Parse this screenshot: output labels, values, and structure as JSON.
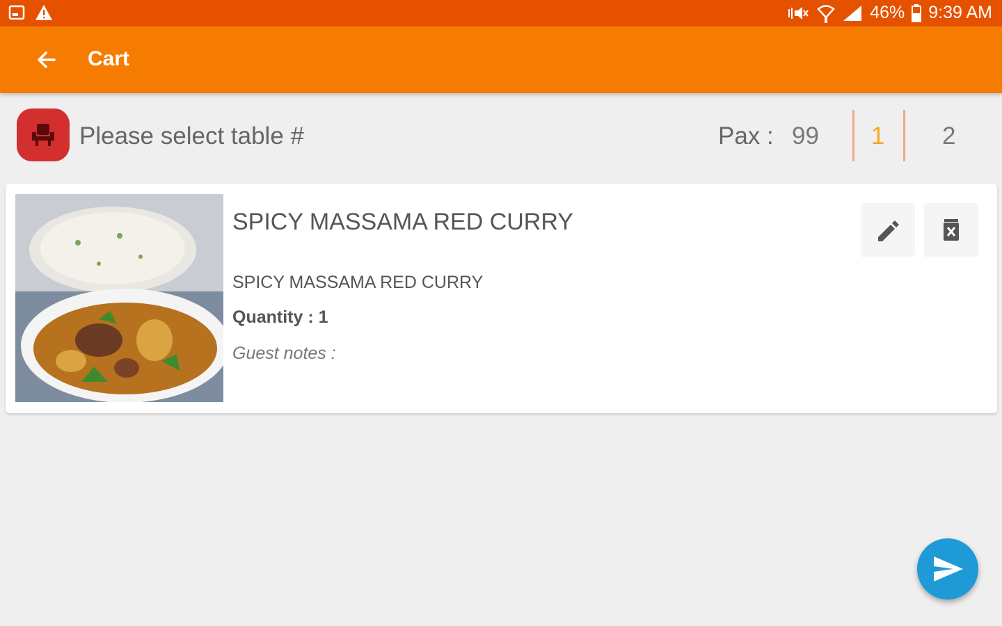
{
  "status_bar": {
    "battery": "46%",
    "time": "9:39 AM",
    "icons": [
      "screenshot-icon",
      "warning-icon",
      "vibrate-mute-icon",
      "wifi-icon",
      "signal-icon",
      "battery-icon"
    ]
  },
  "app_bar": {
    "title": "Cart",
    "back_icon": "arrow-back-icon"
  },
  "table_selector": {
    "prompt": "Please select table #",
    "pax_label": "Pax :",
    "pax_value": "99",
    "seat_options": [
      {
        "label": "1",
        "selected": true
      },
      {
        "label": "2",
        "selected": false
      }
    ]
  },
  "cart_item": {
    "title": "SPICY MASSAMA RED CURRY",
    "description": "SPICY MASSAMA RED CURRY",
    "quantity": "Quantity : 1",
    "guest_notes": "Guest notes :",
    "actions": [
      "edit-icon",
      "delete-icon"
    ]
  },
  "fab": {
    "icon": "send-icon"
  },
  "colors": {
    "status_bar": "#e65100",
    "app_bar": "#f57c00",
    "table_button": "#d32f2f",
    "seat_selected": "#f5a623",
    "seat_unselected": "#777777",
    "fab": "#1e9bd7"
  }
}
